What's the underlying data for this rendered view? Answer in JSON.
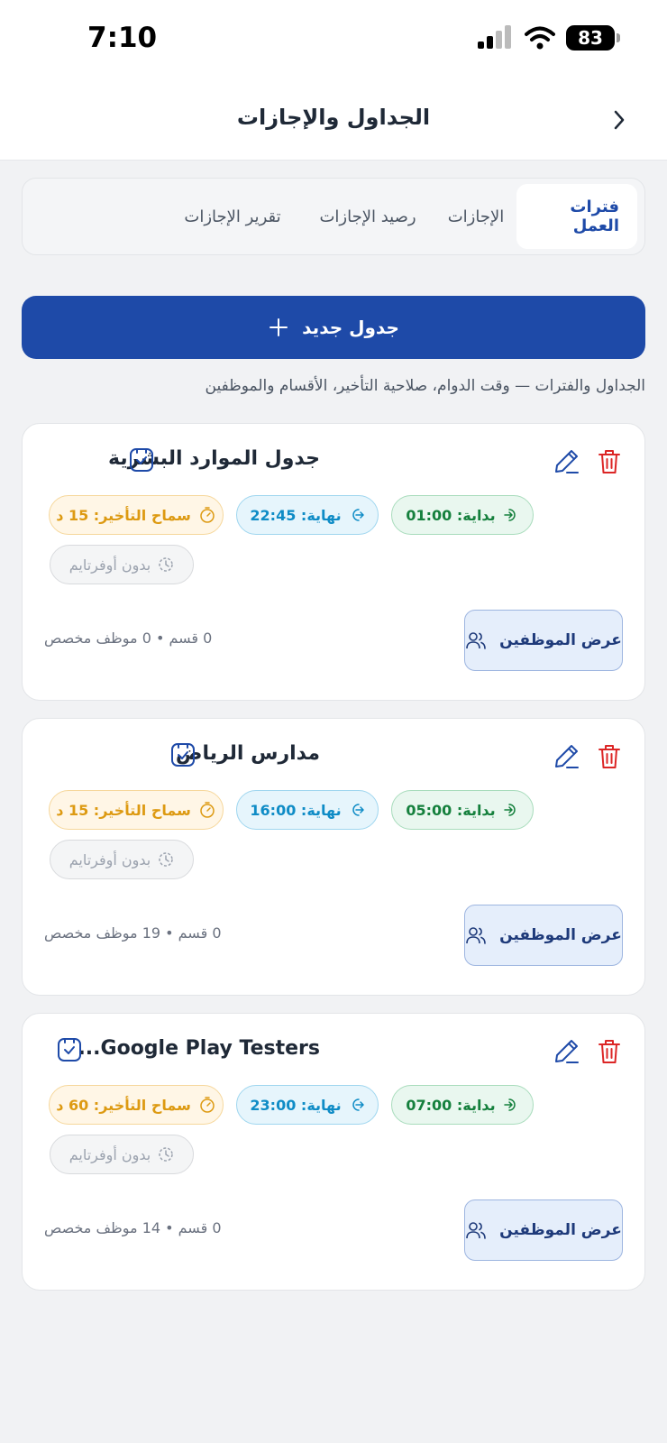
{
  "status": {
    "time": "7:10",
    "battery": "83"
  },
  "header": {
    "title": "الجداول والإجازات"
  },
  "tabs": [
    {
      "label": "فترات العمل"
    },
    {
      "label": "الإجازات"
    },
    {
      "label": "رصيد الإجازات"
    },
    {
      "label": "تقرير الإجازات"
    }
  ],
  "new_button": {
    "label": "جدول جديد"
  },
  "subtitle": "الجداول والفترات — وقت الدوام، صلاحية التأخير، الأقسام والموظفين",
  "cards": [
    {
      "title": "جدول الموارد البشرية",
      "start": "بداية: 01:00",
      "end": "نهاية: 22:45",
      "late": "سماح التأخير: 15 د",
      "overtime": "بدون أوفرتايم",
      "button": "عرض الموظفين",
      "meta": "0 قسم • 0 موظف مخصص"
    },
    {
      "title": "مدارس الرياض",
      "start": "بداية: 05:00",
      "end": "نهاية: 16:00",
      "late": "سماح التأخير: 15 د",
      "overtime": "بدون أوفرتايم",
      "button": "عرض الموظفين",
      "meta": "0 قسم • 19 موظف مخصص"
    },
    {
      "title": "Google Play Testers...",
      "start": "بداية: 07:00",
      "end": "نهاية: 23:00",
      "late": "سماح التأخير: 60 د",
      "overtime": "بدون أوفرتايم",
      "button": "عرض الموظفين",
      "meta": "0 قسم • 14 موظف مخصص"
    }
  ],
  "colors": {
    "primary": "#1e4aa8",
    "start": "#15803d",
    "end": "#0f8cc6",
    "late": "#dd9a12",
    "danger": "#dc2626"
  }
}
